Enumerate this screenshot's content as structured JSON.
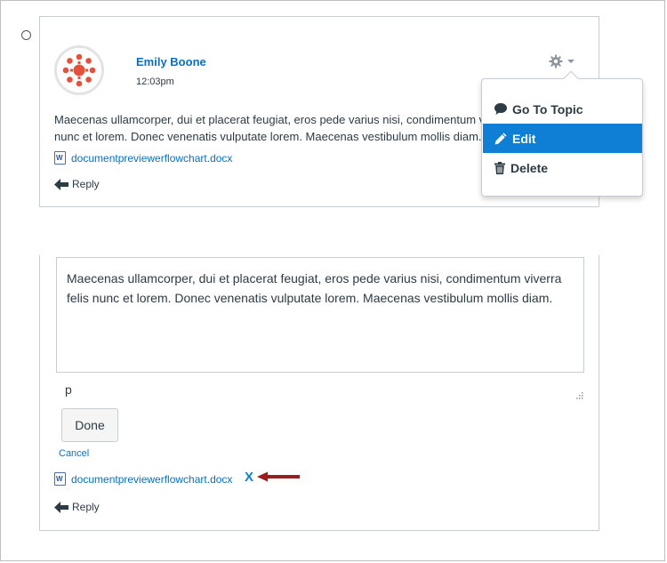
{
  "entry": {
    "author": "Emily Boone",
    "time": "12:03pm",
    "message_line1": "Maecenas ullamcorper, dui et placerat feugiat, eros pede varius nisi, condimentum viverra felis",
    "message_line2": "nunc et lorem. Donec venenatis vulputate lorem. Maecenas vestibulum mollis diam.",
    "attachment": "documentpreviewerflowchart.docx",
    "reply_label": "Reply",
    "settings_icon": "gear-icon"
  },
  "menu": {
    "items": [
      {
        "label": "Go To Topic",
        "icon": "speech-bubble-icon"
      },
      {
        "label": "Edit",
        "icon": "pencil-icon"
      },
      {
        "label": "Delete",
        "icon": "trash-icon"
      }
    ],
    "active_item": "Edit"
  },
  "editor": {
    "text": "Maecenas ullamcorper, dui et placerat feugiat, eros pede varius nisi, condimentum viverra felis nunc et lorem. Donec venenatis vulputate lorem. Maecenas vestibulum mollis diam.",
    "path_label": "p",
    "done_label": "Done",
    "cancel_label": "Cancel",
    "attachment": "documentpreviewerflowchart.docx",
    "remove_label": "X",
    "reply_label": "Reply"
  },
  "colors": {
    "link": "#0770c6",
    "accent": "#0e7fd5",
    "avatar": "#e5523c",
    "annotation_arrow": "#9b1c1c"
  }
}
